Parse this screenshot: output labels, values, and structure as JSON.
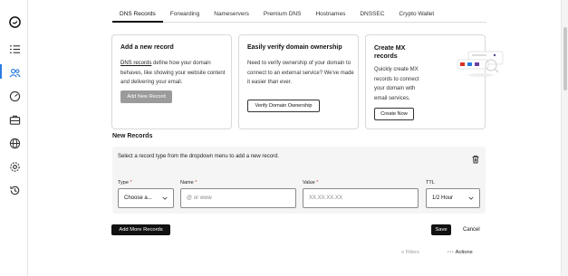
{
  "sidebar": {
    "icons": [
      {
        "name": "brand-logo-icon"
      },
      {
        "name": "list-icon"
      },
      {
        "name": "users-icon"
      },
      {
        "name": "gauge-icon"
      },
      {
        "name": "briefcase-icon"
      },
      {
        "name": "globe-icon"
      },
      {
        "name": "settings-icon"
      },
      {
        "name": "history-icon"
      }
    ]
  },
  "tabs": [
    {
      "label": "DNS Records",
      "active": true
    },
    {
      "label": "Forwarding"
    },
    {
      "label": "Nameservers"
    },
    {
      "label": "Premium DNS"
    },
    {
      "label": "Hostnames"
    },
    {
      "label": "DNSSEC"
    },
    {
      "label": "Crypto Wallet"
    }
  ],
  "cards": {
    "add_record": {
      "title": "Add a new record",
      "link_text": "DNS records",
      "body": " define how your domain behaves, like showing your website content and delivering your email.",
      "button": "Add New Record"
    },
    "verify": {
      "title": "Easily verify domain ownership",
      "body": "Need to verify ownership of your domain to connect to an external service? We've made it easier than ever.",
      "button": "Verify Domain Ownership"
    },
    "mx": {
      "title": "Create MX records",
      "body": "Quickly create MX records to connect your domain with email services.",
      "button": "Create Now"
    }
  },
  "new_records": {
    "title": "New Records",
    "hint": "Select a record type from the dropdown menu to add a new record.",
    "type_label": "Type",
    "type_value": "Choose a...",
    "name_label": "Name",
    "name_placeholder": "@ or www",
    "value_label": "Value",
    "value_placeholder": "XX.XX.XX.XX",
    "ttl_label": "TTL",
    "ttl_value": "1/2 Hour",
    "required_mark": "*"
  },
  "actions": {
    "add_more": "Add More Records",
    "save": "Save",
    "cancel": "Cancel",
    "filters": "Filters",
    "actions": "Actions"
  },
  "colors": {
    "accent": "#2a7de1",
    "dark_button": "#111111",
    "disabled_button": "#9b9b9b"
  }
}
